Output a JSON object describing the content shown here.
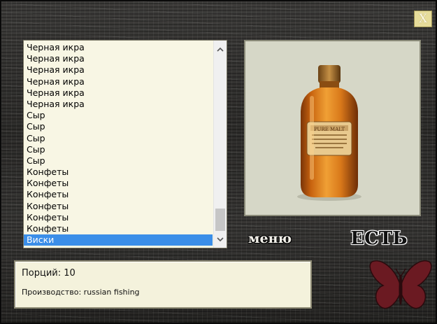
{
  "window": {
    "close_label": "X"
  },
  "list": {
    "items": [
      "Черная икра",
      "Черная икра",
      "Черная икра",
      "Черная икра",
      "Черная икра",
      "Черная икра",
      "Сыр",
      "Сыр",
      "Сыр",
      "Сыр",
      "Сыр",
      "Конфеты",
      "Конфеты",
      "Конфеты",
      "Конфеты",
      "Конфеты",
      "Конфеты",
      "Виски"
    ],
    "selected_index": 17,
    "scroll_up_icon": "chevron-up-icon",
    "scroll_down_icon": "chevron-down-icon"
  },
  "preview": {
    "icon": "whisky-bottle-image",
    "label_text": "PURE MALT"
  },
  "actions": {
    "menu_label": "меню",
    "eat_label": "ЕСТЬ"
  },
  "info": {
    "portions_text": "Порций: 10",
    "producer_text": "Производство: russian fishing"
  },
  "decor": {
    "emblem": "butterfly-icon"
  },
  "colors": {
    "selection": "#3b8ee8",
    "list_bg": "#f8f6e4",
    "panel_bg": "#f4f2dc",
    "butterfly": "#6b1a22"
  }
}
